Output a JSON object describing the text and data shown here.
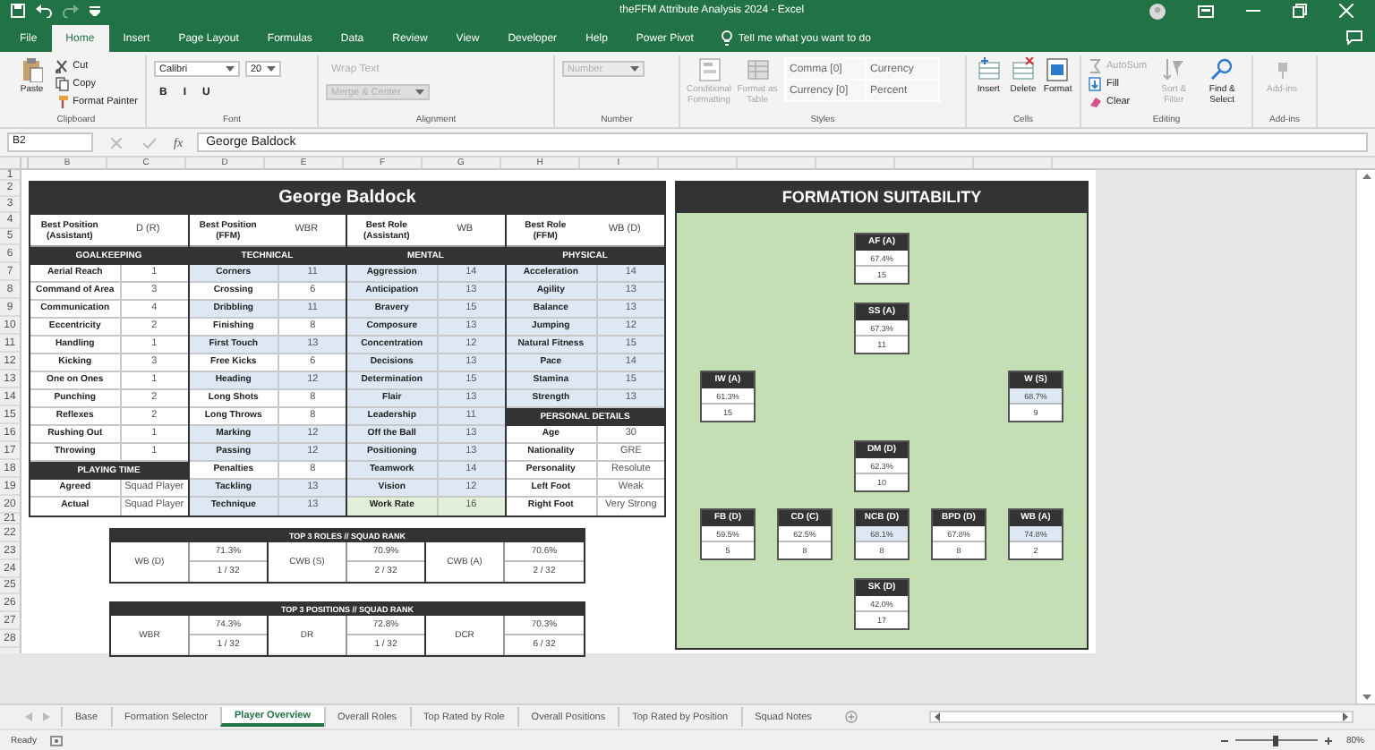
{
  "window": {
    "title": "theFFM Attribute Analysis 2024  -  Excel"
  },
  "menu_tabs": [
    {
      "label": "File",
      "selected": false
    },
    {
      "label": "Home",
      "selected": true
    },
    {
      "label": "Insert",
      "selected": false
    },
    {
      "label": "Page Layout",
      "selected": false
    },
    {
      "label": "Formulas",
      "selected": false
    },
    {
      "label": "Data",
      "selected": false
    },
    {
      "label": "Review",
      "selected": false
    },
    {
      "label": "View",
      "selected": false
    },
    {
      "label": "Developer",
      "selected": false
    },
    {
      "label": "Help",
      "selected": false
    },
    {
      "label": "Power Pivot",
      "selected": false
    }
  ],
  "tell_me": {
    "placeholder": "Tell me what you want to do"
  },
  "ribbon": [
    {
      "name": "Clipboard",
      "columns": [
        {
          "kind": "large",
          "label": "Paste",
          "disabled": false
        },
        {
          "kind": "stack",
          "items": [
            {
              "label": "Cut",
              "disabled": false
            },
            {
              "label": "Copy",
              "disabled": false
            },
            {
              "label": "Format Painter",
              "disabled": false
            }
          ]
        }
      ]
    },
    {
      "name": "Font",
      "columns": [
        {
          "kind": "lines",
          "lines": [
            {
              "controls": [
                {
                  "kind": "dropdown",
                  "label": "Calibri",
                  "disabled": false
                },
                {
                  "kind": "dropdown",
                  "label": "20",
                  "disabled": false
                }
              ]
            },
            {
              "controls": [
                {
                  "kind": "toggle",
                  "label": "B",
                  "disabled": false
                },
                {
                  "kind": "toggle",
                  "label": "I",
                  "disabled": false
                },
                {
                  "kind": "toggle",
                  "label": "U",
                  "disabled": false
                }
              ]
            }
          ]
        }
      ]
    },
    {
      "name": "Alignment",
      "columns": [
        {
          "kind": "lines",
          "lines": [
            {
              "controls": [
                {
                  "kind": "toggle",
                  "label": "Wrap Text",
                  "disabled": true
                }
              ]
            },
            {
              "controls": [
                {
                  "kind": "dropdown",
                  "label": "Merge & Center",
                  "disabled": true
                }
              ]
            }
          ]
        }
      ]
    },
    {
      "name": "Number",
      "columns": [
        {
          "kind": "lines",
          "lines": [
            {
              "controls": [
                {
                  "kind": "dropdown",
                  "label": "Number",
                  "disabled": true
                }
              ]
            }
          ]
        }
      ]
    },
    {
      "name": "Styles",
      "columns": [
        {
          "kind": "large",
          "label": "Conditional Formatting",
          "disabled": true
        },
        {
          "kind": "large",
          "label": "Format as Table",
          "disabled": true
        },
        {
          "kind": "gallery",
          "items": [
            {
              "label": "Comma [0]"
            },
            {
              "label": "Currency"
            },
            {
              "label": "Currency [0]"
            },
            {
              "label": "Percent"
            }
          ]
        }
      ]
    },
    {
      "name": "Cells",
      "columns": [
        {
          "kind": "large",
          "label": "Insert",
          "disabled": false
        },
        {
          "kind": "large",
          "label": "Delete",
          "disabled": false
        },
        {
          "kind": "large",
          "label": "Format",
          "disabled": false
        }
      ]
    },
    {
      "name": "Editing",
      "columns": [
        {
          "kind": "stack",
          "items": [
            {
              "label": "AutoSum",
              "disabled": true
            },
            {
              "label": "Fill",
              "disabled": false
            },
            {
              "label": "Clear",
              "disabled": false
            }
          ]
        },
        {
          "kind": "large",
          "label": "Sort & Filter",
          "disabled": true
        },
        {
          "kind": "large",
          "label": "Find & Select",
          "disabled": false
        }
      ]
    },
    {
      "name": "Add-ins",
      "columns": [
        {
          "kind": "large",
          "label": "Add-ins",
          "disabled": true
        }
      ]
    }
  ],
  "formula_bar": {
    "cell": "B2",
    "fx": "fx",
    "value": "George Baldock"
  },
  "columns": [
    "B",
    "C",
    "D",
    "E",
    "F",
    "G",
    "H",
    "I"
  ],
  "rows": [
    "1",
    "2",
    "3",
    "4",
    "5",
    "6",
    "7",
    "8",
    "9",
    "10",
    "11",
    "12",
    "13",
    "14",
    "15",
    "16",
    "17",
    "18",
    "19",
    "20",
    "21",
    "22",
    "23",
    "24",
    "25",
    "26",
    "27",
    "28"
  ],
  "player": {
    "name": "George Baldock",
    "panels": [
      {
        "best": {
          "label": "Best Position (Assistant)",
          "value": "D (R)"
        },
        "blocks": [
          {
            "kind": "header",
            "title": "GOALKEEPING"
          },
          {
            "kind": "attr",
            "label": "Aerial Reach",
            "value": "1",
            "highlighted": false,
            "best": false
          },
          {
            "kind": "attr",
            "label": "Command of Area",
            "value": "3",
            "highlighted": false,
            "best": false
          },
          {
            "kind": "attr",
            "label": "Communication",
            "value": "4",
            "highlighted": false,
            "best": false
          },
          {
            "kind": "attr",
            "label": "Eccentricity",
            "value": "2",
            "highlighted": false,
            "best": false
          },
          {
            "kind": "attr",
            "label": "Handling",
            "value": "1",
            "highlighted": false,
            "best": false
          },
          {
            "kind": "attr",
            "label": "Kicking",
            "value": "3",
            "highlighted": false,
            "best": false
          },
          {
            "kind": "attr",
            "label": "One on Ones",
            "value": "1",
            "highlighted": false,
            "best": false
          },
          {
            "kind": "attr",
            "label": "Punching",
            "value": "2",
            "highlighted": false,
            "best": false
          },
          {
            "kind": "attr",
            "label": "Reflexes",
            "value": "2",
            "highlighted": false,
            "best": false
          },
          {
            "kind": "attr",
            "label": "Rushing Out",
            "value": "1",
            "highlighted": false,
            "best": false
          },
          {
            "kind": "attr",
            "label": "Throwing",
            "value": "1",
            "highlighted": false,
            "best": false
          },
          {
            "kind": "header",
            "title": "PLAYING TIME"
          },
          {
            "kind": "attr",
            "label": "Agreed",
            "value": "Squad Player",
            "highlighted": false,
            "best": false
          },
          {
            "kind": "attr",
            "label": "Actual",
            "value": "Squad Player",
            "highlighted": false,
            "best": false
          }
        ]
      },
      {
        "best": {
          "label": "Best Position (FFM)",
          "value": "WBR"
        },
        "blocks": [
          {
            "kind": "header",
            "title": "TECHNICAL"
          },
          {
            "kind": "attr",
            "label": "Corners",
            "value": "11",
            "highlighted": true,
            "best": false
          },
          {
            "kind": "attr",
            "label": "Crossing",
            "value": "6",
            "highlighted": false,
            "best": false
          },
          {
            "kind": "attr",
            "label": "Dribbling",
            "value": "11",
            "highlighted": true,
            "best": false
          },
          {
            "kind": "attr",
            "label": "Finishing",
            "value": "8",
            "highlighted": false,
            "best": false
          },
          {
            "kind": "attr",
            "label": "First Touch",
            "value": "13",
            "highlighted": true,
            "best": false
          },
          {
            "kind": "attr",
            "label": "Free Kicks",
            "value": "6",
            "highlighted": false,
            "best": false
          },
          {
            "kind": "attr",
            "label": "Heading",
            "value": "12",
            "highlighted": true,
            "best": false
          },
          {
            "kind": "attr",
            "label": "Long Shots",
            "value": "8",
            "highlighted": false,
            "best": false
          },
          {
            "kind": "attr",
            "label": "Long Throws",
            "value": "8",
            "highlighted": false,
            "best": false
          },
          {
            "kind": "attr",
            "label": "Marking",
            "value": "12",
            "highlighted": true,
            "best": false
          },
          {
            "kind": "attr",
            "label": "Passing",
            "value": "12",
            "highlighted": true,
            "best": false
          },
          {
            "kind": "attr",
            "label": "Penalties",
            "value": "8",
            "highlighted": false,
            "best": false
          },
          {
            "kind": "attr",
            "label": "Tackling",
            "value": "13",
            "highlighted": true,
            "best": false
          },
          {
            "kind": "attr",
            "label": "Technique",
            "value": "13",
            "highlighted": true,
            "best": false
          }
        ]
      },
      {
        "best": {
          "label": "Best Role (Assistant)",
          "value": "WB"
        },
        "blocks": [
          {
            "kind": "header",
            "title": "MENTAL"
          },
          {
            "kind": "attr",
            "label": "Aggression",
            "value": "14",
            "highlighted": true,
            "best": false
          },
          {
            "kind": "attr",
            "label": "Anticipation",
            "value": "13",
            "highlighted": true,
            "best": false
          },
          {
            "kind": "attr",
            "label": "Bravery",
            "value": "15",
            "highlighted": true,
            "best": false
          },
          {
            "kind": "attr",
            "label": "Composure",
            "value": "13",
            "highlighted": true,
            "best": false
          },
          {
            "kind": "attr",
            "label": "Concentration",
            "value": "12",
            "highlighted": true,
            "best": false
          },
          {
            "kind": "attr",
            "label": "Decisions",
            "value": "13",
            "highlighted": true,
            "best": false
          },
          {
            "kind": "attr",
            "label": "Determination",
            "value": "15",
            "highlighted": true,
            "best": false
          },
          {
            "kind": "attr",
            "label": "Flair",
            "value": "13",
            "highlighted": true,
            "best": false
          },
          {
            "kind": "attr",
            "label": "Leadership",
            "value": "11",
            "highlighted": true,
            "best": false
          },
          {
            "kind": "attr",
            "label": "Off the Ball",
            "value": "13",
            "highlighted": true,
            "best": false
          },
          {
            "kind": "attr",
            "label": "Positioning",
            "value": "13",
            "highlighted": true,
            "best": false
          },
          {
            "kind": "attr",
            "label": "Teamwork",
            "value": "14",
            "highlighted": true,
            "best": false
          },
          {
            "kind": "attr",
            "label": "Vision",
            "value": "12",
            "highlighted": true,
            "best": false
          },
          {
            "kind": "attr",
            "label": "Work Rate",
            "value": "16",
            "highlighted": false,
            "best": true
          }
        ]
      },
      {
        "best": {
          "label": "Best Role (FFM)",
          "value": "WB (D)"
        },
        "blocks": [
          {
            "kind": "header",
            "title": "PHYSICAL"
          },
          {
            "kind": "attr",
            "label": "Acceleration",
            "value": "14",
            "highlighted": true,
            "best": false
          },
          {
            "kind": "attr",
            "label": "Agility",
            "value": "13",
            "highlighted": true,
            "best": false
          },
          {
            "kind": "attr",
            "label": "Balance",
            "value": "13",
            "highlighted": true,
            "best": false
          },
          {
            "kind": "attr",
            "label": "Jumping",
            "value": "12",
            "highlighted": true,
            "best": false
          },
          {
            "kind": "attr",
            "label": "Natural Fitness",
            "value": "15",
            "highlighted": true,
            "best": false
          },
          {
            "kind": "attr",
            "label": "Pace",
            "value": "14",
            "highlighted": true,
            "best": false
          },
          {
            "kind": "attr",
            "label": "Stamina",
            "value": "15",
            "highlighted": true,
            "best": false
          },
          {
            "kind": "attr",
            "label": "Strength",
            "value": "13",
            "highlighted": true,
            "best": false
          },
          {
            "kind": "header",
            "title": "PERSONAL DETAILS"
          },
          {
            "kind": "attr",
            "label": "Age",
            "value": "30",
            "highlighted": false,
            "best": false
          },
          {
            "kind": "attr",
            "label": "Nationality",
            "value": "GRE",
            "highlighted": false,
            "best": false
          },
          {
            "kind": "attr",
            "label": "Personality",
            "value": "Resolute",
            "highlighted": false,
            "best": false
          },
          {
            "kind": "attr",
            "label": "Left Foot",
            "value": "Weak",
            "highlighted": false,
            "best": false
          },
          {
            "kind": "attr",
            "label": "Right Foot",
            "value": "Very Strong",
            "highlighted": false,
            "best": false
          }
        ]
      }
    ]
  },
  "rankings": [
    {
      "title": "TOP 3 ROLES // SQUAD RANK",
      "items": [
        {
          "label": "WB (D)",
          "score": "71.3%",
          "rank": "1 / 32"
        },
        {
          "label": "CWB (S)",
          "score": "70.9%",
          "rank": "2 / 32"
        },
        {
          "label": "CWB (A)",
          "score": "70.6%",
          "rank": "2 / 32"
        }
      ]
    },
    {
      "title": "TOP 3 POSITIONS // SQUAD RANK",
      "items": [
        {
          "label": "WBR",
          "score": "74.3%",
          "rank": "1 / 32"
        },
        {
          "label": "DR",
          "score": "72.8%",
          "rank": "1 / 32"
        },
        {
          "label": "DCR",
          "score": "70.3%",
          "rank": "6 / 32"
        }
      ]
    }
  ],
  "formation": {
    "title": "FORMATION SUITABILITY",
    "lines": [
      {
        "center": {
          "label": "AF (A)",
          "score": "67.4%",
          "rank": "15",
          "highlighted": false
        }
      },
      {
        "center": {
          "label": "SS (A)",
          "score": "67.3%",
          "rank": "11",
          "highlighted": false
        }
      },
      {
        "left": {
          "label": "IW (A)",
          "score": "61.3%",
          "rank": "15",
          "highlighted": false
        },
        "right": {
          "label": "W (S)",
          "score": "68.7%",
          "rank": "9",
          "highlighted": true
        }
      },
      {
        "center": {
          "label": "DM (D)",
          "score": "62.3%",
          "rank": "10",
          "highlighted": false
        }
      },
      {
        "left": {
          "label": "FB (D)",
          "score": "59.5%",
          "rank": "5",
          "highlighted": false
        },
        "inner_left": {
          "label": "CD (C)",
          "score": "62.5%",
          "rank": "8",
          "highlighted": false
        },
        "center": {
          "label": "NCB (D)",
          "score": "68.1%",
          "rank": "8",
          "highlighted": true
        },
        "inner_right": {
          "label": "BPD (D)",
          "score": "67.8%",
          "rank": "8",
          "highlighted": false
        },
        "right": {
          "label": "WB (A)",
          "score": "74.8%",
          "rank": "2",
          "highlighted": true
        }
      },
      {
        "center": {
          "label": "SK (D)",
          "score": "42.0%",
          "rank": "17",
          "highlighted": false
        }
      }
    ]
  },
  "sheet_tabs": [
    {
      "label": "Base",
      "selected": false
    },
    {
      "label": "Formation Selector",
      "selected": false
    },
    {
      "label": "Player Overview",
      "selected": true
    },
    {
      "label": "Overall Roles",
      "selected": false
    },
    {
      "label": "Top Rated by Role",
      "selected": false
    },
    {
      "label": "Overall Positions",
      "selected": false
    },
    {
      "label": "Top Rated by Position",
      "selected": false
    },
    {
      "label": "Squad Notes",
      "selected": false
    }
  ],
  "status_bar": {
    "status": "Ready",
    "zoom_slider": {
      "level": 0.5
    },
    "zoom": "80%"
  }
}
